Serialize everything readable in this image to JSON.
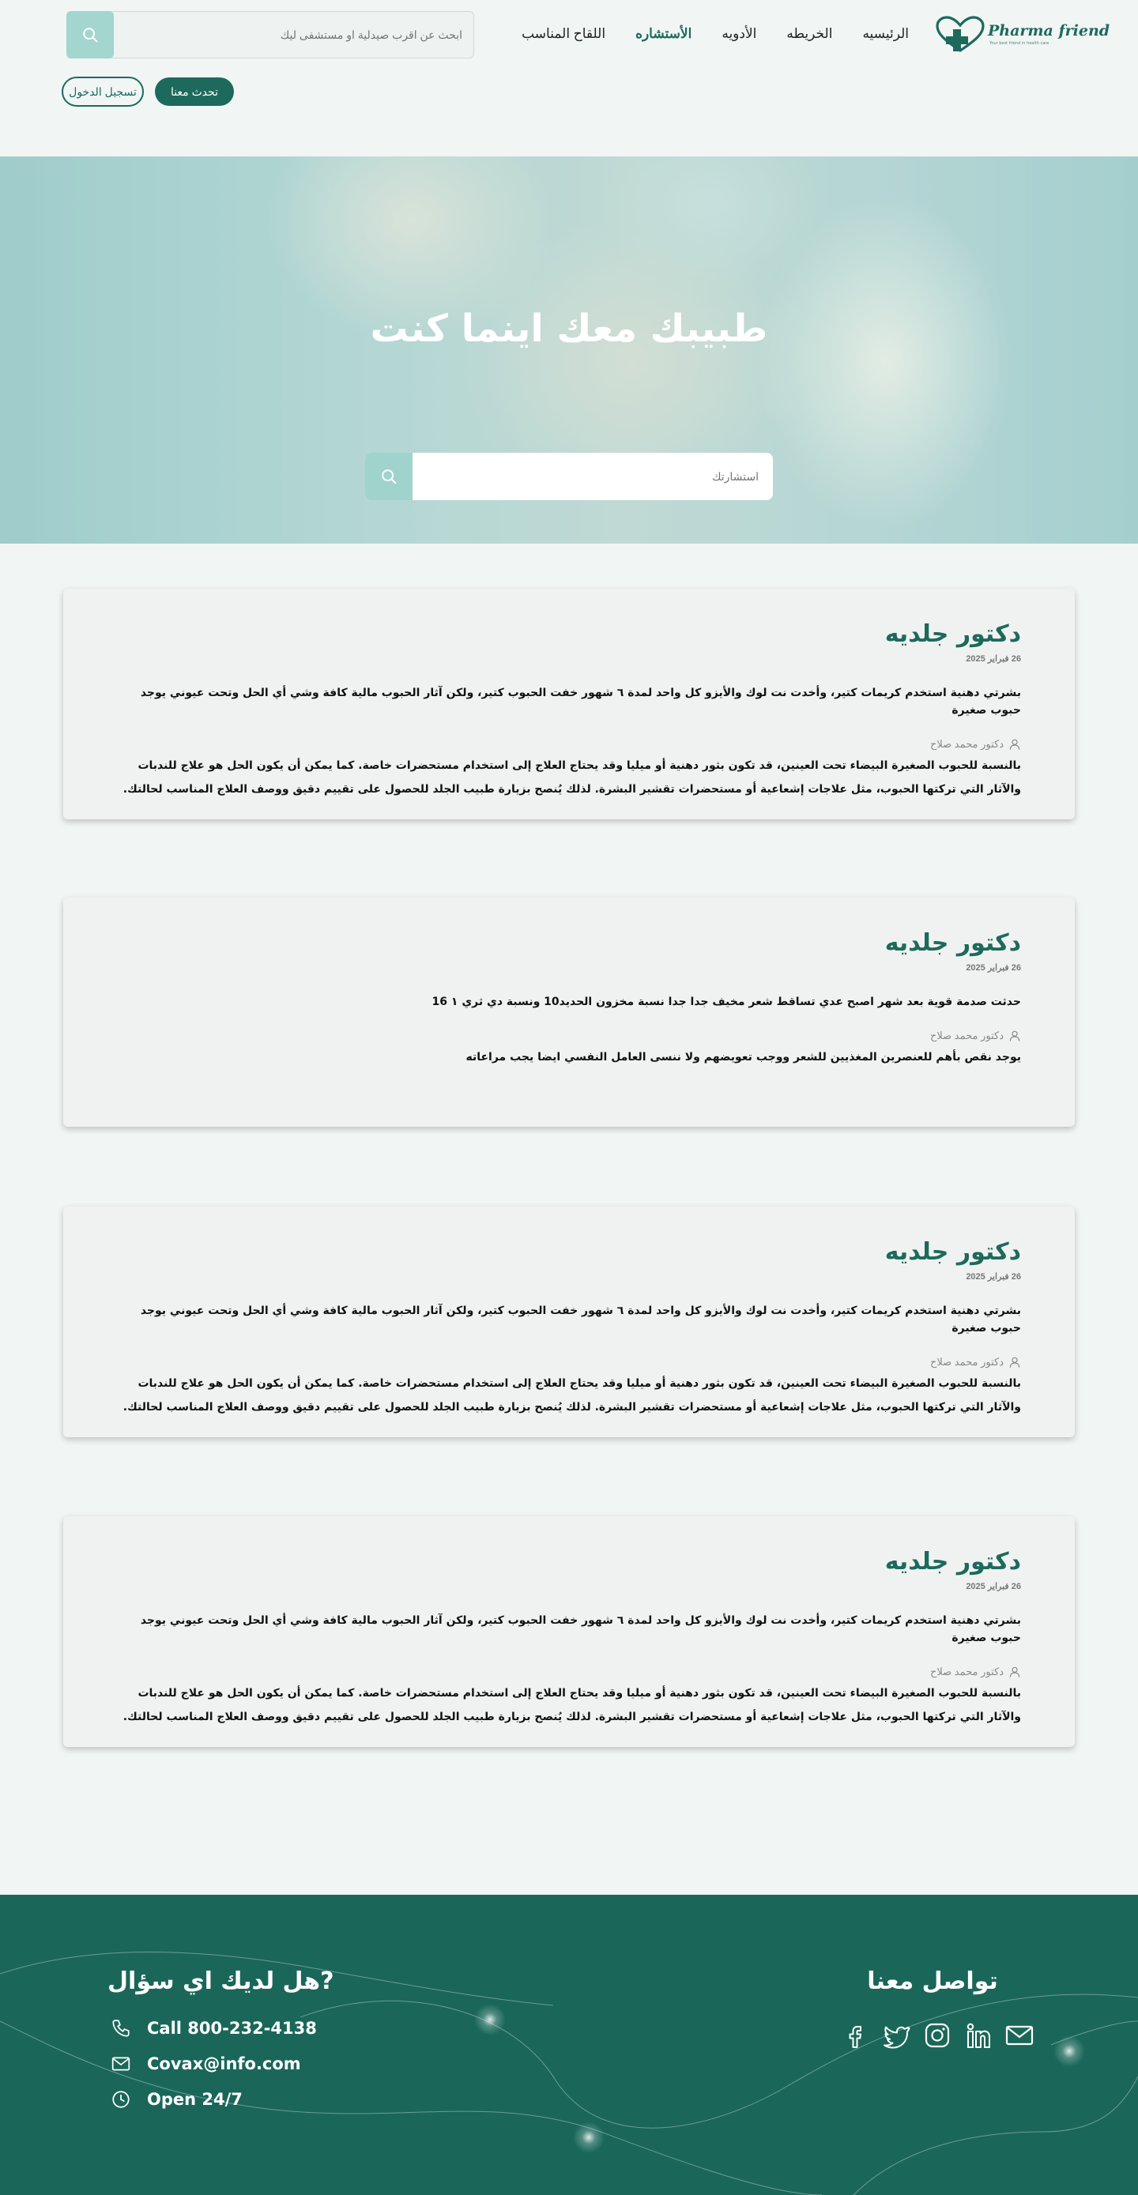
{
  "brand": {
    "name": "Pharma friend",
    "tagline": "Your best friend in health care",
    "colors": {
      "primary": "#1d6a5c",
      "accent": "#a2d6cf",
      "background": "#f1f5f4",
      "footer": "#1a675a"
    }
  },
  "nav": {
    "items": [
      {
        "label": "الرئيسيه",
        "active": false
      },
      {
        "label": "الخريطه",
        "active": false
      },
      {
        "label": "الأدويه",
        "active": false
      },
      {
        "label": "الأستشاره",
        "active": true
      },
      {
        "label": "اللقاح المناسب",
        "active": false
      }
    ]
  },
  "top_search": {
    "placeholder": "ابحث عن اقرب صيدلية او مستشفى ليك",
    "icon": "search-icon"
  },
  "auth": {
    "contact_label": "تحدث معنا",
    "login_label": "تسجيل الدخول"
  },
  "hero": {
    "title": "طبيبك معك اينما كنت",
    "search_placeholder": "استشارتك",
    "icon": "search-icon"
  },
  "consultations": [
    {
      "title": "دكتور جلديه",
      "date": "26 فبراير 2025",
      "question": "بشرتي دهنية استخدم كريمات كتير، وأخدت نت لوك والأيزو كل واحد لمدة ٦ شهور خفت الحبوب كتير، ولكن آثار الحبوب مالية كافة وشي أي الحل وتحت عيوني يوجد حبوب صغيرة",
      "doctor": "دكتور محمد صلاح",
      "answer": "بالنسبة للحبوب الصغيرة البيضاء تحت العينين، قد تكون بثور دهنية أو ميليا وقد يحتاج العلاج إلى استخدام مستحضرات خاصة. كما يمكن أن يكون الحل هو علاج للندبات والآثار التي تركتها الحبوب، مثل علاجات إشعاعية أو مستحضرات تقشير البشرة. لذلك يُنصح بزيارة طبيب الجلد للحصول على تقييم دقيق ووصف العلاج المناسب لحالتك."
    },
    {
      "title": "دكتور جلديه",
      "date": "26 فبراير 2025",
      "question": "حدثت صدمة قوية بعد شهر اصبح عدي تساقط شعر مخيف جدا جدا نسبة مخزون الحديد10 ونسبة دي ثري ١ 16",
      "doctor": "دكتور محمد صلاح",
      "answer": "يوجد نقص بأهم للعنصرين المغذيين للشعر ووجب تعويضهم ولا ننسى العامل النفسي ايضا يجب مراعاته"
    },
    {
      "title": "دكتور جلديه",
      "date": "26 فبراير 2025",
      "question": "بشرتي دهنية استخدم كريمات كتير، وأخدت نت لوك والأيزو كل واحد لمدة ٦ شهور خفت الحبوب كتير، ولكن آثار الحبوب مالية كافة وشي أي الحل وتحت عيوني يوجد حبوب صغيرة",
      "doctor": "دكتور محمد صلاح",
      "answer": "بالنسبة للحبوب الصغيرة البيضاء تحت العينين، قد تكون بثور دهنية أو ميليا وقد يحتاج العلاج إلى استخدام مستحضرات خاصة. كما يمكن أن يكون الحل هو علاج للندبات والآثار التي تركتها الحبوب، مثل علاجات إشعاعية أو مستحضرات تقشير البشرة. لذلك يُنصح بزيارة طبيب الجلد للحصول على تقييم دقيق ووصف العلاج المناسب لحالتك."
    },
    {
      "title": "دكتور جلديه",
      "date": "26 فبراير 2025",
      "question": "بشرتي دهنية استخدم كريمات كتير، وأخدت نت لوك والأيزو كل واحد لمدة ٦ شهور خفت الحبوب كتير، ولكن آثار الحبوب مالية كافة وشي أي الحل وتحت عيوني يوجد حبوب صغيرة",
      "doctor": "دكتور محمد صلاح",
      "answer": "بالنسبة للحبوب الصغيرة البيضاء تحت العينين، قد تكون بثور دهنية أو ميليا وقد يحتاج العلاج إلى استخدام مستحضرات خاصة. كما يمكن أن يكون الحل هو علاج للندبات والآثار التي تركتها الحبوب، مثل علاجات إشعاعية أو مستحضرات تقشير البشرة. لذلك يُنصح بزيارة طبيب الجلد للحصول على تقييم دقيق ووصف العلاج المناسب لحالتك."
    }
  ],
  "footer": {
    "question_title": "هل لديك اي سؤال?",
    "phone": "Call 800-232-4138",
    "email": "Covax@info.com",
    "hours": "Open 24/7",
    "contact_title": "تواصل معنا",
    "social": [
      "facebook-icon",
      "twitter-icon",
      "instagram-icon",
      "linkedin-icon",
      "mail-icon"
    ]
  }
}
